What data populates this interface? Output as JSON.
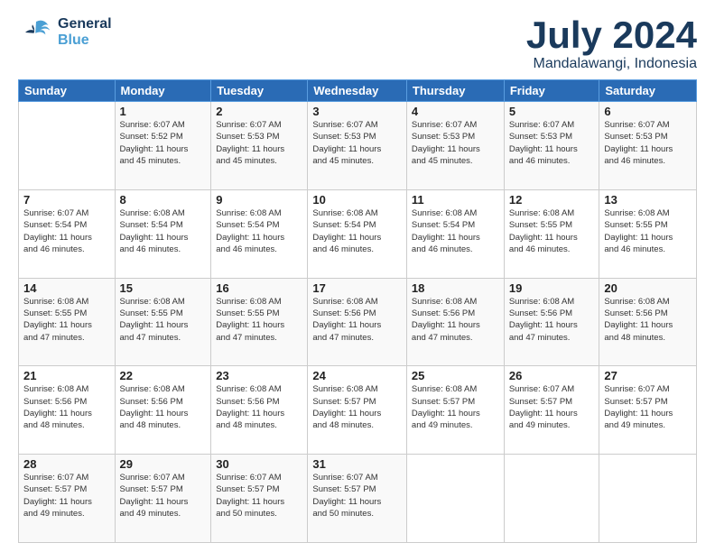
{
  "header": {
    "logo_general": "General",
    "logo_blue": "Blue",
    "title": "July 2024",
    "subtitle": "Mandalawangi, Indonesia"
  },
  "days_of_week": [
    "Sunday",
    "Monday",
    "Tuesday",
    "Wednesday",
    "Thursday",
    "Friday",
    "Saturday"
  ],
  "weeks": [
    [
      {
        "day": "",
        "info": ""
      },
      {
        "day": "1",
        "info": "Sunrise: 6:07 AM\nSunset: 5:52 PM\nDaylight: 11 hours\nand 45 minutes."
      },
      {
        "day": "2",
        "info": "Sunrise: 6:07 AM\nSunset: 5:53 PM\nDaylight: 11 hours\nand 45 minutes."
      },
      {
        "day": "3",
        "info": "Sunrise: 6:07 AM\nSunset: 5:53 PM\nDaylight: 11 hours\nand 45 minutes."
      },
      {
        "day": "4",
        "info": "Sunrise: 6:07 AM\nSunset: 5:53 PM\nDaylight: 11 hours\nand 45 minutes."
      },
      {
        "day": "5",
        "info": "Sunrise: 6:07 AM\nSunset: 5:53 PM\nDaylight: 11 hours\nand 46 minutes."
      },
      {
        "day": "6",
        "info": "Sunrise: 6:07 AM\nSunset: 5:53 PM\nDaylight: 11 hours\nand 46 minutes."
      }
    ],
    [
      {
        "day": "7",
        "info": "Sunrise: 6:07 AM\nSunset: 5:54 PM\nDaylight: 11 hours\nand 46 minutes."
      },
      {
        "day": "8",
        "info": "Sunrise: 6:08 AM\nSunset: 5:54 PM\nDaylight: 11 hours\nand 46 minutes."
      },
      {
        "day": "9",
        "info": "Sunrise: 6:08 AM\nSunset: 5:54 PM\nDaylight: 11 hours\nand 46 minutes."
      },
      {
        "day": "10",
        "info": "Sunrise: 6:08 AM\nSunset: 5:54 PM\nDaylight: 11 hours\nand 46 minutes."
      },
      {
        "day": "11",
        "info": "Sunrise: 6:08 AM\nSunset: 5:54 PM\nDaylight: 11 hours\nand 46 minutes."
      },
      {
        "day": "12",
        "info": "Sunrise: 6:08 AM\nSunset: 5:55 PM\nDaylight: 11 hours\nand 46 minutes."
      },
      {
        "day": "13",
        "info": "Sunrise: 6:08 AM\nSunset: 5:55 PM\nDaylight: 11 hours\nand 46 minutes."
      }
    ],
    [
      {
        "day": "14",
        "info": "Sunrise: 6:08 AM\nSunset: 5:55 PM\nDaylight: 11 hours\nand 47 minutes."
      },
      {
        "day": "15",
        "info": "Sunrise: 6:08 AM\nSunset: 5:55 PM\nDaylight: 11 hours\nand 47 minutes."
      },
      {
        "day": "16",
        "info": "Sunrise: 6:08 AM\nSunset: 5:55 PM\nDaylight: 11 hours\nand 47 minutes."
      },
      {
        "day": "17",
        "info": "Sunrise: 6:08 AM\nSunset: 5:56 PM\nDaylight: 11 hours\nand 47 minutes."
      },
      {
        "day": "18",
        "info": "Sunrise: 6:08 AM\nSunset: 5:56 PM\nDaylight: 11 hours\nand 47 minutes."
      },
      {
        "day": "19",
        "info": "Sunrise: 6:08 AM\nSunset: 5:56 PM\nDaylight: 11 hours\nand 47 minutes."
      },
      {
        "day": "20",
        "info": "Sunrise: 6:08 AM\nSunset: 5:56 PM\nDaylight: 11 hours\nand 48 minutes."
      }
    ],
    [
      {
        "day": "21",
        "info": "Sunrise: 6:08 AM\nSunset: 5:56 PM\nDaylight: 11 hours\nand 48 minutes."
      },
      {
        "day": "22",
        "info": "Sunrise: 6:08 AM\nSunset: 5:56 PM\nDaylight: 11 hours\nand 48 minutes."
      },
      {
        "day": "23",
        "info": "Sunrise: 6:08 AM\nSunset: 5:56 PM\nDaylight: 11 hours\nand 48 minutes."
      },
      {
        "day": "24",
        "info": "Sunrise: 6:08 AM\nSunset: 5:57 PM\nDaylight: 11 hours\nand 48 minutes."
      },
      {
        "day": "25",
        "info": "Sunrise: 6:08 AM\nSunset: 5:57 PM\nDaylight: 11 hours\nand 49 minutes."
      },
      {
        "day": "26",
        "info": "Sunrise: 6:07 AM\nSunset: 5:57 PM\nDaylight: 11 hours\nand 49 minutes."
      },
      {
        "day": "27",
        "info": "Sunrise: 6:07 AM\nSunset: 5:57 PM\nDaylight: 11 hours\nand 49 minutes."
      }
    ],
    [
      {
        "day": "28",
        "info": "Sunrise: 6:07 AM\nSunset: 5:57 PM\nDaylight: 11 hours\nand 49 minutes."
      },
      {
        "day": "29",
        "info": "Sunrise: 6:07 AM\nSunset: 5:57 PM\nDaylight: 11 hours\nand 49 minutes."
      },
      {
        "day": "30",
        "info": "Sunrise: 6:07 AM\nSunset: 5:57 PM\nDaylight: 11 hours\nand 50 minutes."
      },
      {
        "day": "31",
        "info": "Sunrise: 6:07 AM\nSunset: 5:57 PM\nDaylight: 11 hours\nand 50 minutes."
      },
      {
        "day": "",
        "info": ""
      },
      {
        "day": "",
        "info": ""
      },
      {
        "day": "",
        "info": ""
      }
    ]
  ]
}
